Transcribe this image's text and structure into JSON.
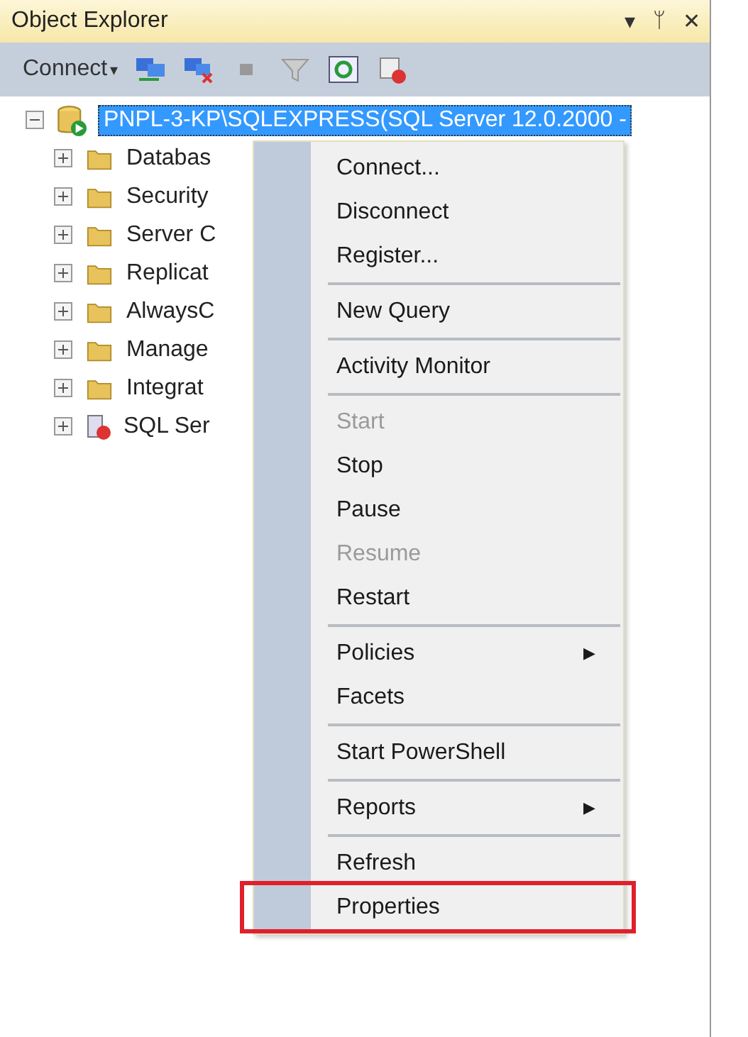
{
  "panel": {
    "title": "Object Explorer",
    "controls": [
      "▾",
      "ᛘ",
      "✕"
    ]
  },
  "toolbar": {
    "connect": "Connect",
    "caret": "▾"
  },
  "server": {
    "label": "PNPL-3-KP\\SQLEXPRESS(SQL Server 12.0.2000 -",
    "expanded": true,
    "selected": true
  },
  "tree": [
    {
      "label": "Databas",
      "kind": "folder"
    },
    {
      "label": "Security",
      "kind": "folder"
    },
    {
      "label": "Server C",
      "kind": "folder"
    },
    {
      "label": "Replicat",
      "kind": "folder"
    },
    {
      "label": "AlwaysC",
      "kind": "folder"
    },
    {
      "label": "Manage",
      "kind": "folder"
    },
    {
      "label": "Integrat",
      "kind": "folder"
    },
    {
      "label": "SQL Ser",
      "kind": "agent"
    }
  ],
  "menu": [
    {
      "kind": "item",
      "label": "Connect...",
      "disabled": false
    },
    {
      "kind": "item",
      "label": "Disconnect",
      "disabled": false
    },
    {
      "kind": "item",
      "label": "Register...",
      "disabled": false
    },
    {
      "kind": "separator"
    },
    {
      "kind": "item",
      "label": "New Query",
      "disabled": false
    },
    {
      "kind": "separator"
    },
    {
      "kind": "item",
      "label": "Activity Monitor",
      "disabled": false
    },
    {
      "kind": "separator"
    },
    {
      "kind": "item",
      "label": "Start",
      "disabled": true
    },
    {
      "kind": "item",
      "label": "Stop",
      "disabled": false
    },
    {
      "kind": "item",
      "label": "Pause",
      "disabled": false
    },
    {
      "kind": "item",
      "label": "Resume",
      "disabled": true
    },
    {
      "kind": "item",
      "label": "Restart",
      "disabled": false
    },
    {
      "kind": "separator"
    },
    {
      "kind": "item",
      "label": "Policies",
      "disabled": false,
      "arrow": "▶"
    },
    {
      "kind": "item",
      "label": "Facets",
      "disabled": false
    },
    {
      "kind": "separator"
    },
    {
      "kind": "item",
      "label": "Start PowerShell",
      "disabled": false
    },
    {
      "kind": "separator"
    },
    {
      "kind": "item",
      "label": "Reports",
      "disabled": false,
      "arrow": "▶"
    },
    {
      "kind": "separator"
    },
    {
      "kind": "item",
      "label": "Refresh",
      "disabled": false
    },
    {
      "kind": "item",
      "label": "Properties",
      "disabled": false,
      "highlighted": true
    }
  ]
}
